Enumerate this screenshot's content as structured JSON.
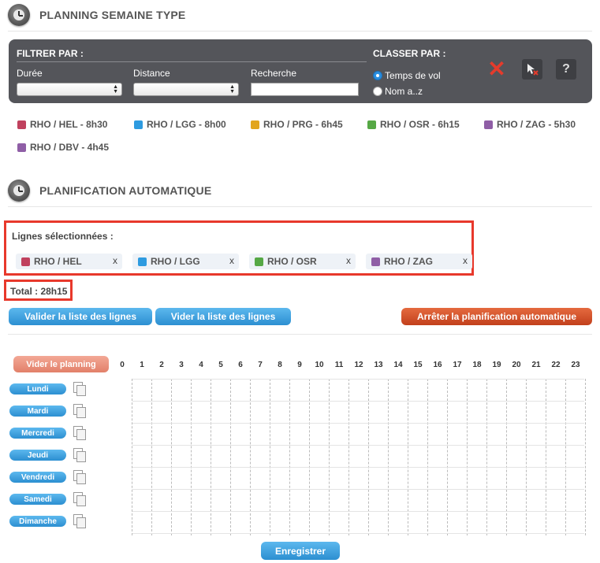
{
  "sections": {
    "planning_title": "PLANNING SEMAINE TYPE",
    "auto_title": "PLANIFICATION AUTOMATIQUE"
  },
  "filter": {
    "title": "FILTRER PAR :",
    "duree_label": "Durée",
    "distance_label": "Distance",
    "recherche_label": "Recherche",
    "sort_title": "CLASSER PAR :",
    "sort_options": [
      "Temps de vol",
      "Nom a..z"
    ],
    "sort_selected": "Temps de vol"
  },
  "lines": [
    {
      "label": "RHO / HEL - 8h30",
      "color": "#c0415e"
    },
    {
      "label": "RHO / LGG - 8h00",
      "color": "#2e9be0"
    },
    {
      "label": "RHO / PRG - 6h45",
      "color": "#e2a51d"
    },
    {
      "label": "RHO / OSR - 6h15",
      "color": "#56a845"
    },
    {
      "label": "RHO / ZAG - 5h30",
      "color": "#8f5ea6"
    },
    {
      "label": "RHO / DBV - 4h45",
      "color": "#8f5ea6"
    }
  ],
  "selected": {
    "title": "Lignes sélectionnées :",
    "items": [
      {
        "label": "RHO / HEL",
        "color": "#c0415e"
      },
      {
        "label": "RHO / LGG",
        "color": "#2e9be0"
      },
      {
        "label": "RHO / OSR",
        "color": "#56a845"
      },
      {
        "label": "RHO / ZAG",
        "color": "#8f5ea6"
      }
    ],
    "remove_label": "x"
  },
  "total": "Total : 28h15",
  "buttons": {
    "validate": "Valider la liste des lignes",
    "clear_list": "Vider la liste des lignes",
    "stop": "Arrêter la planification automatique",
    "clear_planning": "Vider le planning",
    "save": "Enregistrer"
  },
  "hours": [
    "0",
    "1",
    "2",
    "3",
    "4",
    "5",
    "6",
    "7",
    "8",
    "9",
    "10",
    "11",
    "12",
    "13",
    "14",
    "15",
    "16",
    "17",
    "18",
    "19",
    "20",
    "21",
    "22",
    "23"
  ],
  "days": [
    "Lundi",
    "Mardi",
    "Mercredi",
    "Jeudi",
    "Vendredi",
    "Samedi",
    "Dimanche"
  ],
  "icons": {
    "section": "clock-icon",
    "clear_filters": "close-icon",
    "reset_cursor": "cursor-reset-icon",
    "help": "help-icon",
    "copy": "copy-icon"
  }
}
